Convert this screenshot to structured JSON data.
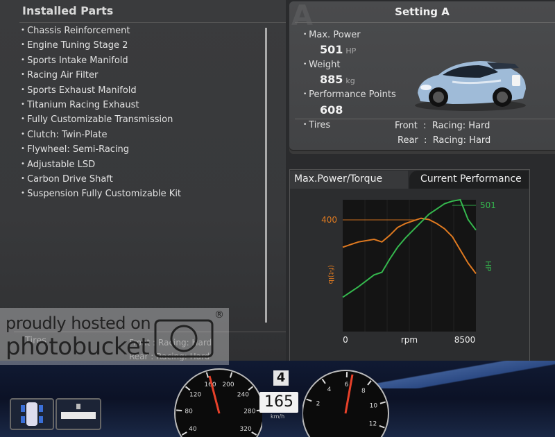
{
  "installed_parts": {
    "title": "Installed Parts",
    "items": [
      "Chassis Reinforcement",
      "Engine Tuning Stage 2",
      "Sports Intake Manifold",
      "Racing Air Filter",
      "Sports Exhaust Manifold",
      "Titanium Racing Exhaust",
      "Fully Customizable Transmission",
      "Clutch: Twin-Plate",
      "Flywheel: Semi-Racing",
      "Adjustable LSD",
      "Carbon Drive Shaft",
      "Suspension Fully Customizable Kit"
    ],
    "ghost_tires_label": "Tires",
    "ghost_front": "Front  :  Racing: Hard",
    "ghost_rear": "Rear  :  Racing: Hard"
  },
  "setting": {
    "tab_letter": "A",
    "title": "Setting A",
    "max_power_label": "Max. Power",
    "max_power_value": "501",
    "max_power_unit": "HP",
    "weight_label": "Weight",
    "weight_value": "885",
    "weight_unit": "kg",
    "pp_label": "Performance Points",
    "pp_value": "608",
    "tires_label": "Tires",
    "front_label": "Front",
    "front_value": "Racing: Hard",
    "rear_label": "Rear",
    "rear_value": "Racing: Hard",
    "colon": ":"
  },
  "chart_tabs": {
    "active": "Max.Power/Torque",
    "inactive": "Current Performance"
  },
  "chart_data": {
    "type": "line",
    "xlabel": "rpm",
    "x_tick_labels": [
      "0",
      "8500"
    ],
    "xlim": [
      0,
      8500
    ],
    "ylim_power": [
      0,
      501
    ],
    "torque_marker_label": "400",
    "power_marker_label": "501",
    "left_axis_label": "(f-t)lb",
    "right_axis_label": "HP",
    "series": [
      {
        "color": "#e07a20",
        "x": [
          0,
          1000,
          2000,
          2500,
          3000,
          3500,
          4000,
          4500,
          5000,
          5500,
          6000,
          6500,
          7000,
          7500,
          8000,
          8500
        ],
        "y": [
          0.64,
          0.68,
          0.7,
          0.68,
          0.73,
          0.79,
          0.82,
          0.84,
          0.86,
          0.85,
          0.82,
          0.78,
          0.72,
          0.62,
          0.52,
          0.44
        ]
      },
      {
        "color": "#35b84e",
        "x": [
          0,
          1000,
          2000,
          2500,
          3000,
          3500,
          4000,
          4500,
          5000,
          5500,
          6000,
          6500,
          7000,
          7500,
          8000,
          8500
        ],
        "y": [
          0.26,
          0.34,
          0.43,
          0.45,
          0.55,
          0.64,
          0.71,
          0.77,
          0.83,
          0.89,
          0.93,
          0.97,
          0.99,
          1.0,
          0.85,
          0.77
        ]
      }
    ]
  },
  "hud": {
    "gear": "4",
    "speed": "165",
    "speed_unit": "km/h",
    "speedo_ticks": [
      "40",
      "80",
      "120",
      "160",
      "200",
      "240",
      "280",
      "320"
    ],
    "tacho_ticks": [
      "2",
      "4",
      "6",
      "8",
      "10",
      "12"
    ]
  },
  "watermark": {
    "line1": "proudly hosted on",
    "line2": "photobucket",
    "reg": "®"
  }
}
